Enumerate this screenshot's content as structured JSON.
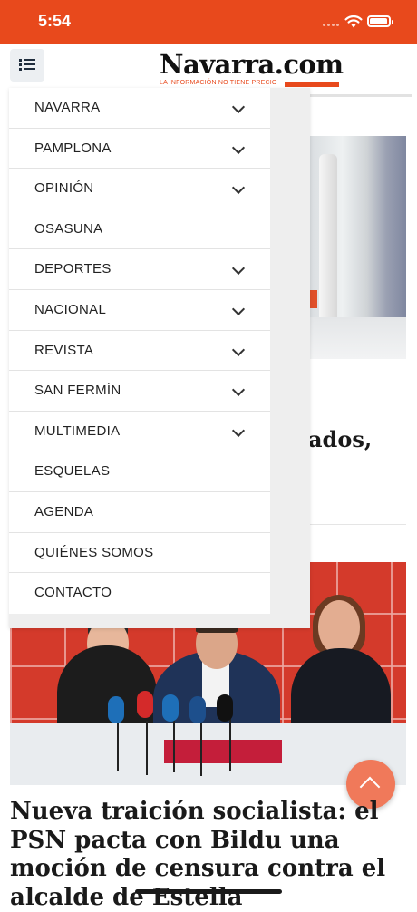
{
  "status_bar": {
    "time": "5:54",
    "background": "#e8491c"
  },
  "header": {
    "menu_icon": "list-icon",
    "logo": {
      "name": "Navarra.com",
      "tagline": "LA INFORMACIÓN NO TIENE PRECIO"
    }
  },
  "menu": {
    "items": [
      {
        "label": "NAVARRA",
        "has_submenu": true
      },
      {
        "label": "PAMPLONA",
        "has_submenu": true
      },
      {
        "label": "OPINIÓN",
        "has_submenu": true
      },
      {
        "label": "OSASUNA",
        "has_submenu": false
      },
      {
        "label": "DEPORTES",
        "has_submenu": true
      },
      {
        "label": "NACIONAL",
        "has_submenu": true
      },
      {
        "label": "REVISTA",
        "has_submenu": true
      },
      {
        "label": "SAN FERMÍN",
        "has_submenu": true
      },
      {
        "label": "MULTIMEDIA",
        "has_submenu": true
      },
      {
        "label": "ESQUELAS",
        "has_submenu": false
      },
      {
        "label": "AGENDA",
        "has_submenu": false
      },
      {
        "label": "QUIÉNES SOMOS",
        "has_submenu": false
      },
      {
        "label": "CONTACTO",
        "has_submenu": false
      }
    ]
  },
  "articles": [
    {
      "headline_fragment": "ados,"
    },
    {
      "headline": "Nueva traición socialista: el PSN pacta con Bildu una moción de censura contra el alcalde de Estella"
    }
  ],
  "scroll_top_icon": "chevron-up-icon",
  "accent_color": "#e8491c"
}
